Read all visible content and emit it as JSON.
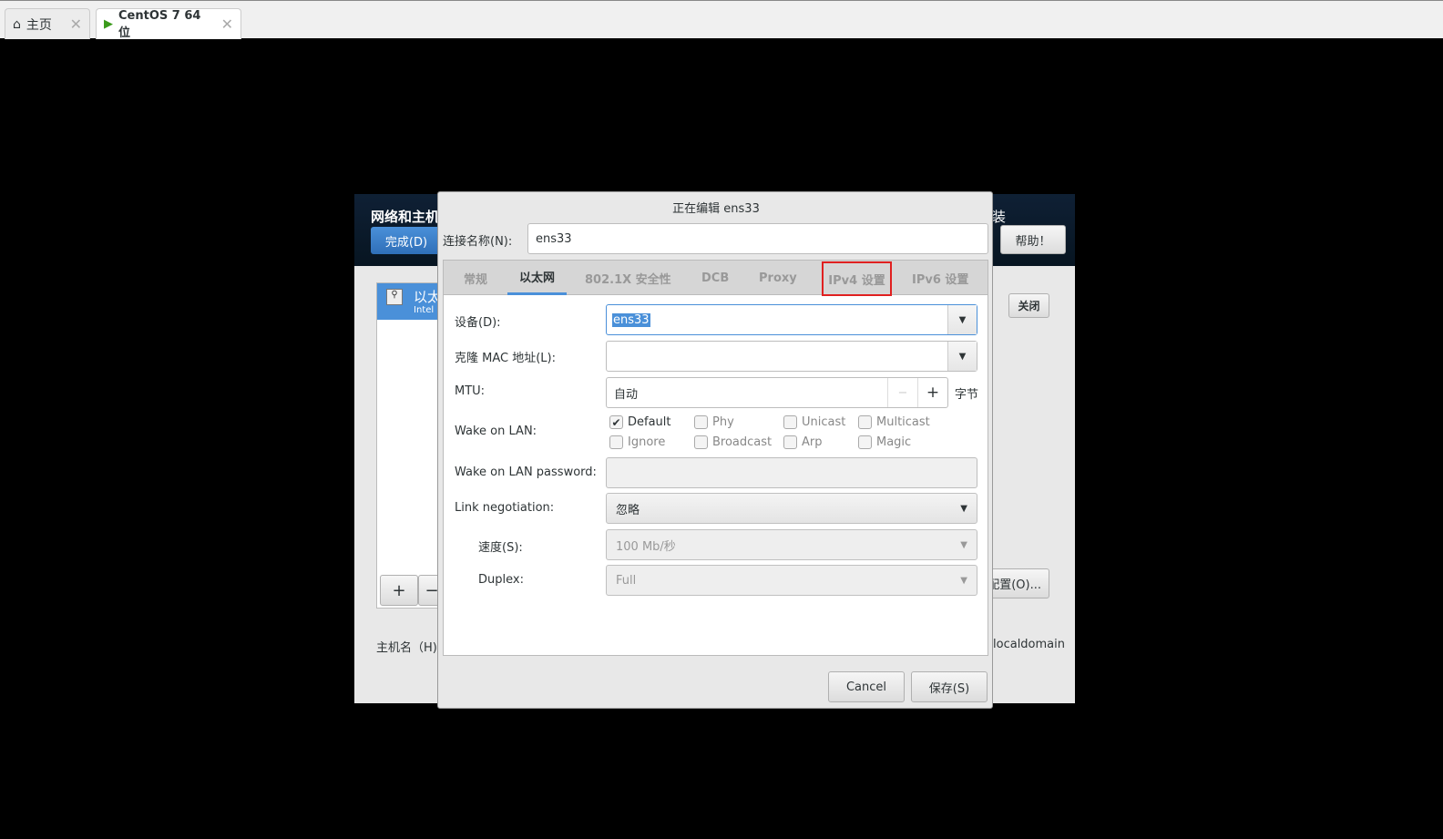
{
  "vm_tabs": [
    {
      "label": "主页",
      "icon": "home-icon"
    },
    {
      "label": "CentOS 7 64 位",
      "icon": "vm-icon"
    }
  ],
  "background": {
    "title": "网络和主机",
    "done_button": "完成(D)",
    "right_title_fragment": "装",
    "help_button": "帮助！",
    "device_name": "以太",
    "device_desc": "Intel",
    "off_button": "关闭",
    "configure_button": "配置(O)...",
    "hostname_label": "主机名（H)",
    "hostname_value": "t.localdomain",
    "add_button": "+",
    "remove_button": "−"
  },
  "dialog": {
    "title": "正在编辑 ens33",
    "connection_name_label": "连接名称(N):",
    "connection_name_value": "ens33",
    "tabs": [
      "常规",
      "以太网",
      "802.1X 安全性",
      "DCB",
      "Proxy",
      "IPv4 设置",
      "IPv6 设置"
    ],
    "active_tab": "以太网",
    "highlighted_tab": "IPv4 设置",
    "device_label": "设备(D):",
    "device_value": "ens33",
    "mac_label": "克隆 MAC 地址(L):",
    "mac_value": "",
    "mtu_label": "MTU:",
    "mtu_value": "自动",
    "mtu_unit": "字节",
    "mtu_minus": "−",
    "mtu_plus": "+",
    "wol_label": "Wake on LAN:",
    "wol_options": [
      {
        "label": "Default",
        "checked": true
      },
      {
        "label": "Phy",
        "checked": false
      },
      {
        "label": "Unicast",
        "checked": false
      },
      {
        "label": "Multicast",
        "checked": false
      },
      {
        "label": "Ignore",
        "checked": false
      },
      {
        "label": "Broadcast",
        "checked": false
      },
      {
        "label": "Arp",
        "checked": false
      },
      {
        "label": "Magic",
        "checked": false
      }
    ],
    "wol_password_label": "Wake on LAN password:",
    "wol_password_value": "",
    "link_neg_label": "Link negotiation:",
    "link_neg_value": "忽略",
    "speed_label": "速度(S):",
    "speed_value": "100 Mb/秒",
    "duplex_label": "Duplex:",
    "duplex_value": "Full",
    "cancel_button": "Cancel",
    "save_button": "保存(S)"
  },
  "colors": {
    "accent": "#4a90d9",
    "highlight_box": "#e02020",
    "header": "#0b1a2a"
  }
}
